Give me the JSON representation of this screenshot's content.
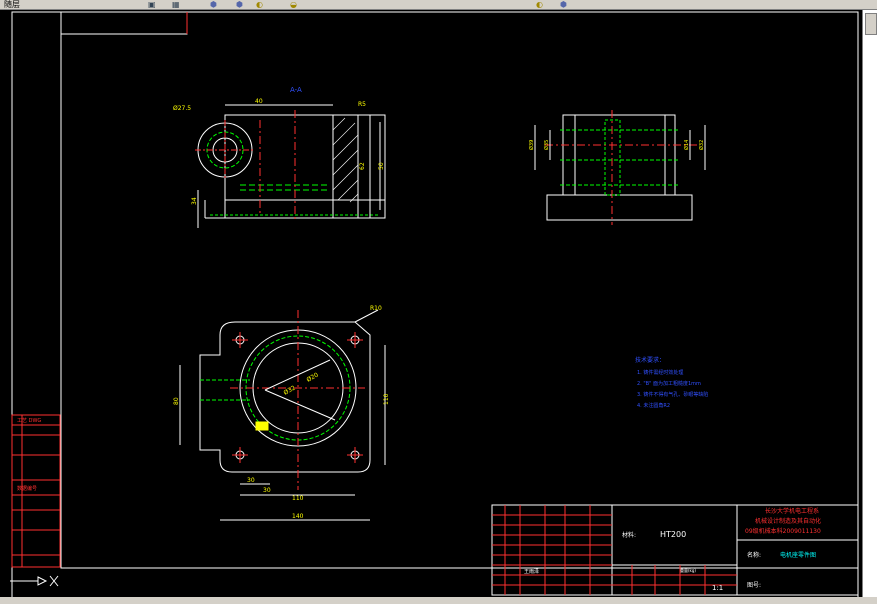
{
  "toolbar": {
    "left_label": "随层",
    "items": [
      "⬢",
      "⬢",
      "◐",
      "◒",
      "⬢",
      "◐"
    ]
  },
  "drawing": {
    "section_label": "A-A",
    "top_view_dims": {
      "width_top": "40",
      "r_label": "R5",
      "dia_label": "Ø27.5",
      "height_right": "62",
      "height_right2": "50",
      "left_small": "34"
    },
    "right_view_dims": {
      "d1": "Ø39",
      "d2": "Ø35",
      "d3": "Ø14",
      "d4": "Ø32"
    },
    "plan_view_dims": {
      "top_right": "R10",
      "dia_big": "Ø32",
      "dia_small": "Ø20",
      "r_small": "R6",
      "left_height": "80",
      "right_height": "110",
      "bottom_a": "30",
      "bottom_b": "30",
      "bottom_c": "110",
      "bottom_total": "140"
    },
    "notes": {
      "title": "技术要求：",
      "lines": [
        "1. 铸件需经时效处理",
        "2. \"B\" 面为加工粗糙度1mm",
        "3. 铸件不得有气孔、砂眼等缺陷",
        "4. 未注圆角R2"
      ]
    },
    "left_strip": {
      "label1": "工艺 DWG",
      "label2": "数据编号"
    },
    "title_block": {
      "school_1": "长沙大学机电工程系",
      "school_2": "机械设计制造及其自动化",
      "school_3": "09级机械本科2009011130",
      "material_label": "材料:",
      "material_value": "HT200",
      "part_name_label": "名称:",
      "part_name_value": "电机座零件图",
      "drawing_no_label": "图号:",
      "scale": "1:1",
      "weight_label": "重量(kg)",
      "designer_label": "王雨泽"
    }
  },
  "colors": {
    "white": "#ffffff",
    "green": "#00ff00",
    "red": "#ff3030",
    "yellow": "#ffff00",
    "cyan": "#00ffff",
    "blue": "#3050ff",
    "magenta": "#ff00ff"
  }
}
